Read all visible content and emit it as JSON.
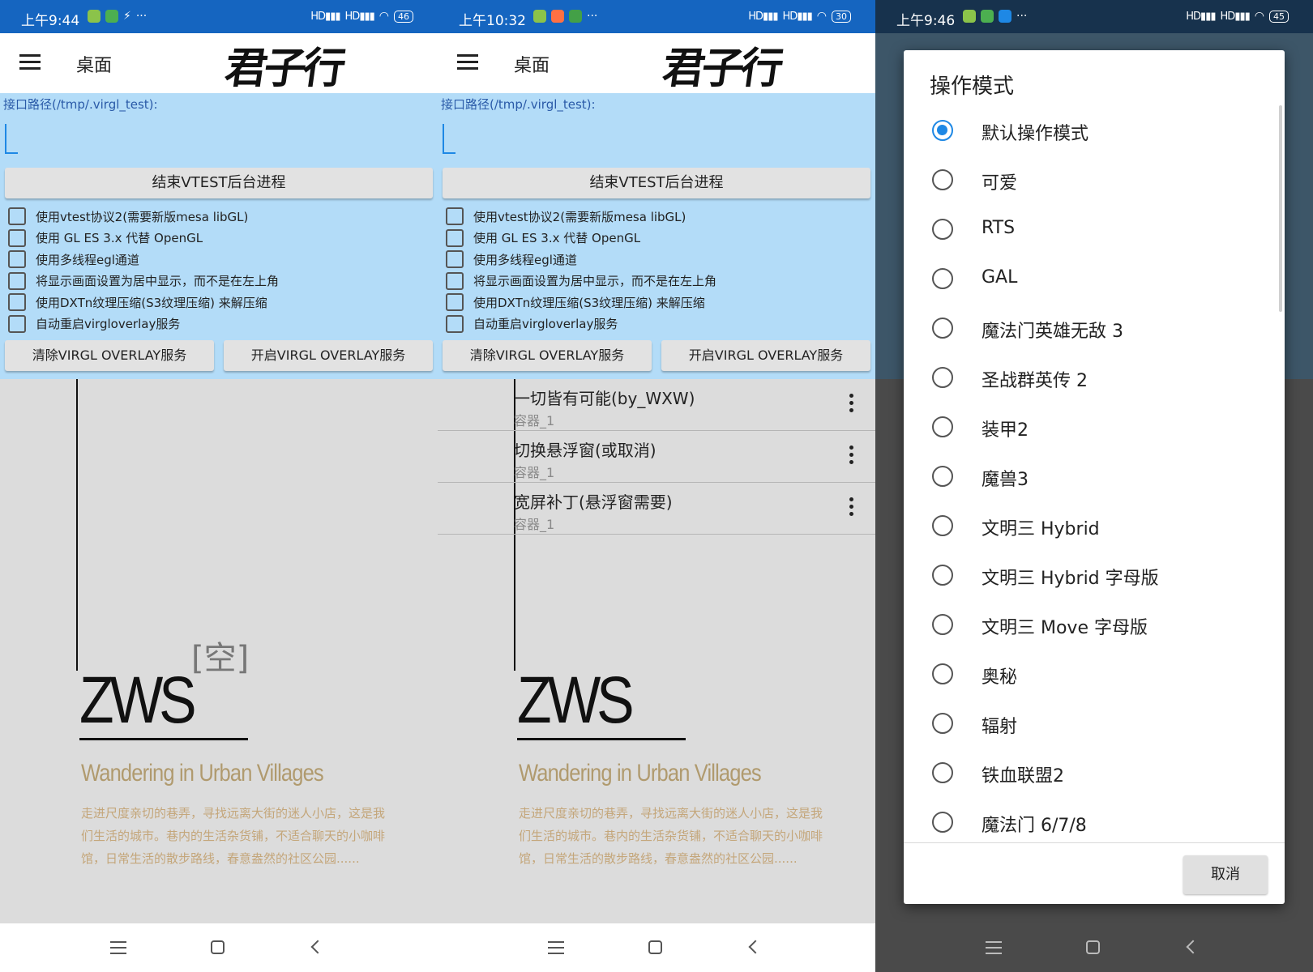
{
  "colors": {
    "statusbar": "#1565c0",
    "form_bg": "#b3dcf8",
    "accent": "#1e88e5",
    "content_bg": "#dcdcdc"
  },
  "screens": [
    {
      "status": {
        "time": "上午9:44",
        "battery": "46",
        "sig1": "HD",
        "sig2": "HD"
      },
      "toolbar": {
        "title": "桌面",
        "logo": "君子行"
      },
      "form": {
        "path_label": "接口路径(/tmp/.virgl_test):",
        "path_value": "",
        "stop_button": "结束VTEST后台进程",
        "checkboxes": [
          "使用vtest协议2(需要新版mesa libGL)",
          "使用 GL ES 3.x 代替 OpenGL",
          "使用多线程egl通道",
          "将显示画面设置为居中显示，而不是在左上角",
          "使用DXTn纹理压缩(S3纹理压缩) 来解压缩",
          "自动重启virgloverlay服务"
        ],
        "clear_button": "清除VIRGL OVERLAY服务",
        "start_button": "开启VIRGL OVERLAY服务"
      },
      "content": {
        "empty": "[空]",
        "wallpaper": {
          "brand": "ZWS",
          "subtitle": "Wandering in Urban Villages",
          "description": "走进尺度亲切的巷弄，寻找远离大街的迷人小店，这是我们生活的城市。巷内的生活杂货铺，不适合聊天的小咖啡馆，日常生活的散步路线，春意盎然的社区公园......"
        }
      }
    },
    {
      "status": {
        "time": "上午10:32",
        "battery": "30",
        "sig1": "HD",
        "sig2": "HD"
      },
      "toolbar": {
        "title": "桌面",
        "logo": "君子行"
      },
      "form": {
        "path_label": "接口路径(/tmp/.virgl_test):",
        "path_value": "",
        "stop_button": "结束VTEST后台进程",
        "checkboxes": [
          "使用vtest协议2(需要新版mesa libGL)",
          "使用 GL ES 3.x 代替 OpenGL",
          "使用多线程egl通道",
          "将显示画面设置为居中显示，而不是在左上角",
          "使用DXTn纹理压缩(S3纹理压缩) 来解压缩",
          "自动重启virgloverlay服务"
        ],
        "clear_button": "清除VIRGL OVERLAY服务",
        "start_button": "开启VIRGL OVERLAY服务"
      },
      "content": {
        "items": [
          {
            "title": "一切皆有可能(by_WXW)",
            "sub": "容器_1"
          },
          {
            "title": "切换悬浮窗(或取消)",
            "sub": "容器_1"
          },
          {
            "title": "宽屏补丁(悬浮窗需要)",
            "sub": "容器_1"
          }
        ],
        "wallpaper": {
          "brand": "ZWS",
          "subtitle": "Wandering in Urban Villages",
          "description": "走进尺度亲切的巷弄，寻找远离大街的迷人小店，这是我们生活的城市。巷内的生活杂货铺，不适合聊天的小咖啡馆，日常生活的散步路线，春意盎然的社区公园......"
        }
      }
    },
    {
      "status": {
        "time": "上午9:46",
        "battery": "45",
        "sig1": "HD",
        "sig2": "HD"
      },
      "dialog": {
        "title": "操作模式",
        "selected": "默认操作模式",
        "options": [
          "默认操作模式",
          "可爱",
          "RTS",
          "GAL",
          "魔法门英雄无敌 3",
          "圣战群英传 2",
          "装甲2",
          "魔兽3",
          "文明三 Hybrid",
          "文明三 Hybrid 字母版",
          "文明三 Move 字母版",
          "奥秘",
          "辐射",
          "铁血联盟2",
          "魔法门 6/7/8"
        ],
        "cancel": "取消"
      }
    }
  ]
}
